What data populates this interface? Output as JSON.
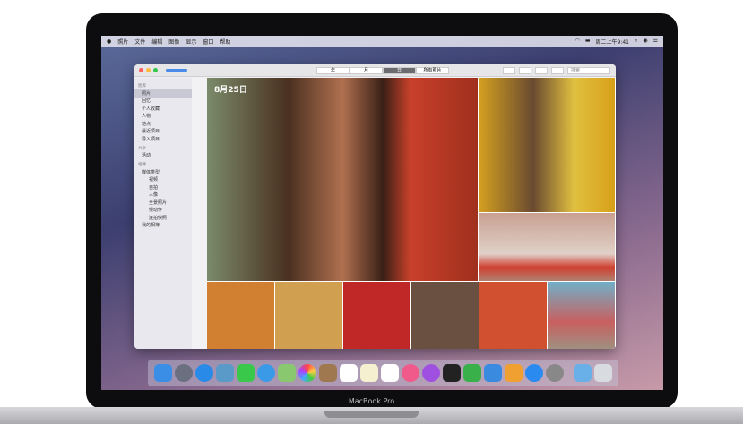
{
  "menubar": {
    "apple": "",
    "items": [
      "照片",
      "文件",
      "编辑",
      "图像",
      "显示",
      "窗口",
      "帮助"
    ],
    "clock": "周二上午9:41"
  },
  "toolbar": {
    "segments": [
      "年",
      "月",
      "日",
      "所有照片"
    ],
    "search_placeholder": "搜索"
  },
  "sidebar": {
    "library_header": "图库",
    "library": [
      "照片",
      "回忆",
      "个人收藏",
      "人物",
      "地点",
      "最近项目",
      "导入项目"
    ],
    "shared_header": "共享",
    "shared": [
      "活动"
    ],
    "albums_header": "相簿",
    "media_types": "媒体类型",
    "media": [
      "视频",
      "自拍",
      "人像",
      "全景照片",
      "慢动作",
      "连拍快照"
    ],
    "my_albums": "我的相簿"
  },
  "content": {
    "date": "8月25日"
  },
  "brand": "MacBook Pro",
  "dock": [
    "finder",
    "launchpad",
    "safari",
    "photos-app",
    "messages",
    "mail",
    "maps",
    "photos",
    "contacts",
    "calendar",
    "notes",
    "reminders",
    "music",
    "podcasts",
    "tv",
    "numbers",
    "keynote",
    "pages",
    "app-store",
    "system-preferences",
    "folder",
    "trash"
  ]
}
